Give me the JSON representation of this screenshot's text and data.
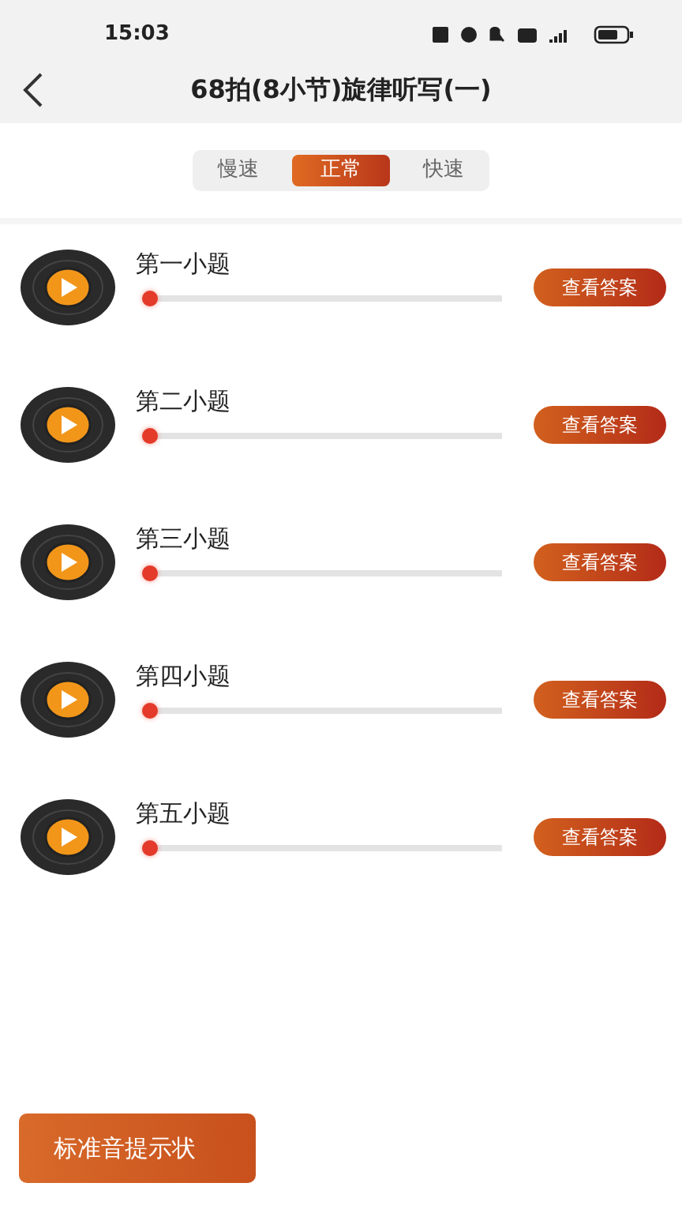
{
  "status_bar": {
    "time": "15:03"
  },
  "header": {
    "title": "68拍(8小节)旋律听写(一)"
  },
  "speed_tabs": [
    {
      "label": "慢速",
      "selected": false
    },
    {
      "label": "正常",
      "selected": true
    },
    {
      "label": "快速",
      "selected": false
    }
  ],
  "questions": [
    {
      "title": "第一小题",
      "level": 0,
      "button": "查看答案"
    },
    {
      "title": "第二小题",
      "level": 0,
      "button": "查看答案"
    },
    {
      "title": "第三小题",
      "level": 0,
      "button": "查看答案"
    },
    {
      "title": "第四小题",
      "level": 0,
      "button": "查看答案"
    },
    {
      "title": "第五小题",
      "level": 0,
      "button": "查看答案"
    }
  ],
  "bottom_button": "标准音提示状"
}
